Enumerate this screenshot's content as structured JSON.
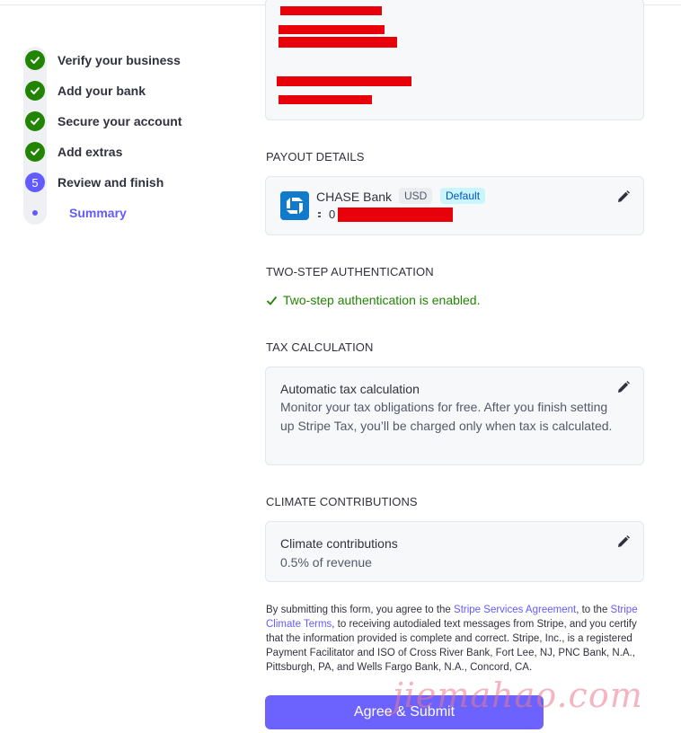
{
  "steps": [
    {
      "label": "Verify your business",
      "state": "done"
    },
    {
      "label": "Add your bank",
      "state": "done"
    },
    {
      "label": "Secure your account",
      "state": "done"
    },
    {
      "label": "Add extras",
      "state": "done"
    },
    {
      "label": "Review and finish",
      "state": "current",
      "number": "5"
    },
    {
      "label": "Summary",
      "state": "substep"
    }
  ],
  "payout": {
    "heading": "PAYOUT DETAILS",
    "bank_name": "CHASE Bank",
    "currency_badge": "USD",
    "default_badge": "Default",
    "account_prefix": "0",
    "bank_color": "#117aca"
  },
  "two_step": {
    "heading": "TWO-STEP AUTHENTICATION",
    "status": "Two-step authentication is enabled."
  },
  "tax": {
    "heading": "TAX CALCULATION",
    "title": "Automatic tax calculation",
    "body": "Monitor your tax obligations for free. After you finish setting up Stripe Tax, you’ll be charged only when tax is calculated."
  },
  "climate": {
    "heading": "CLIMATE CONTRIBUTIONS",
    "title": "Climate contributions",
    "value": "0.5% of revenue"
  },
  "legal": {
    "text_1": "By submitting this form, you agree to the ",
    "link_1": "Stripe Services Agreement",
    "text_2": ", to the ",
    "link_2": "Stripe Climate Terms",
    "text_3": ", to receiving autodialed text messages from Stripe, and you certify that the information provided is complete and correct. Stripe, Inc., is a registered Payment Facilitator and ISO of Cross River Bank, Fort Lee, NJ, PNC Bank, N.A., Pittsburgh, PA, and Wells Fargo Bank, N.A., Concord, CA."
  },
  "submit_label": "Agree & Submit",
  "watermark": "jiemahao.com",
  "colors": {
    "accent": "#635bff",
    "success": "#228403",
    "redaction": "#e8000b"
  },
  "icons": {
    "done": "check-circle-icon",
    "edit": "pencil-icon",
    "bank": "chase-logo-icon",
    "ok": "checkmark-icon"
  }
}
